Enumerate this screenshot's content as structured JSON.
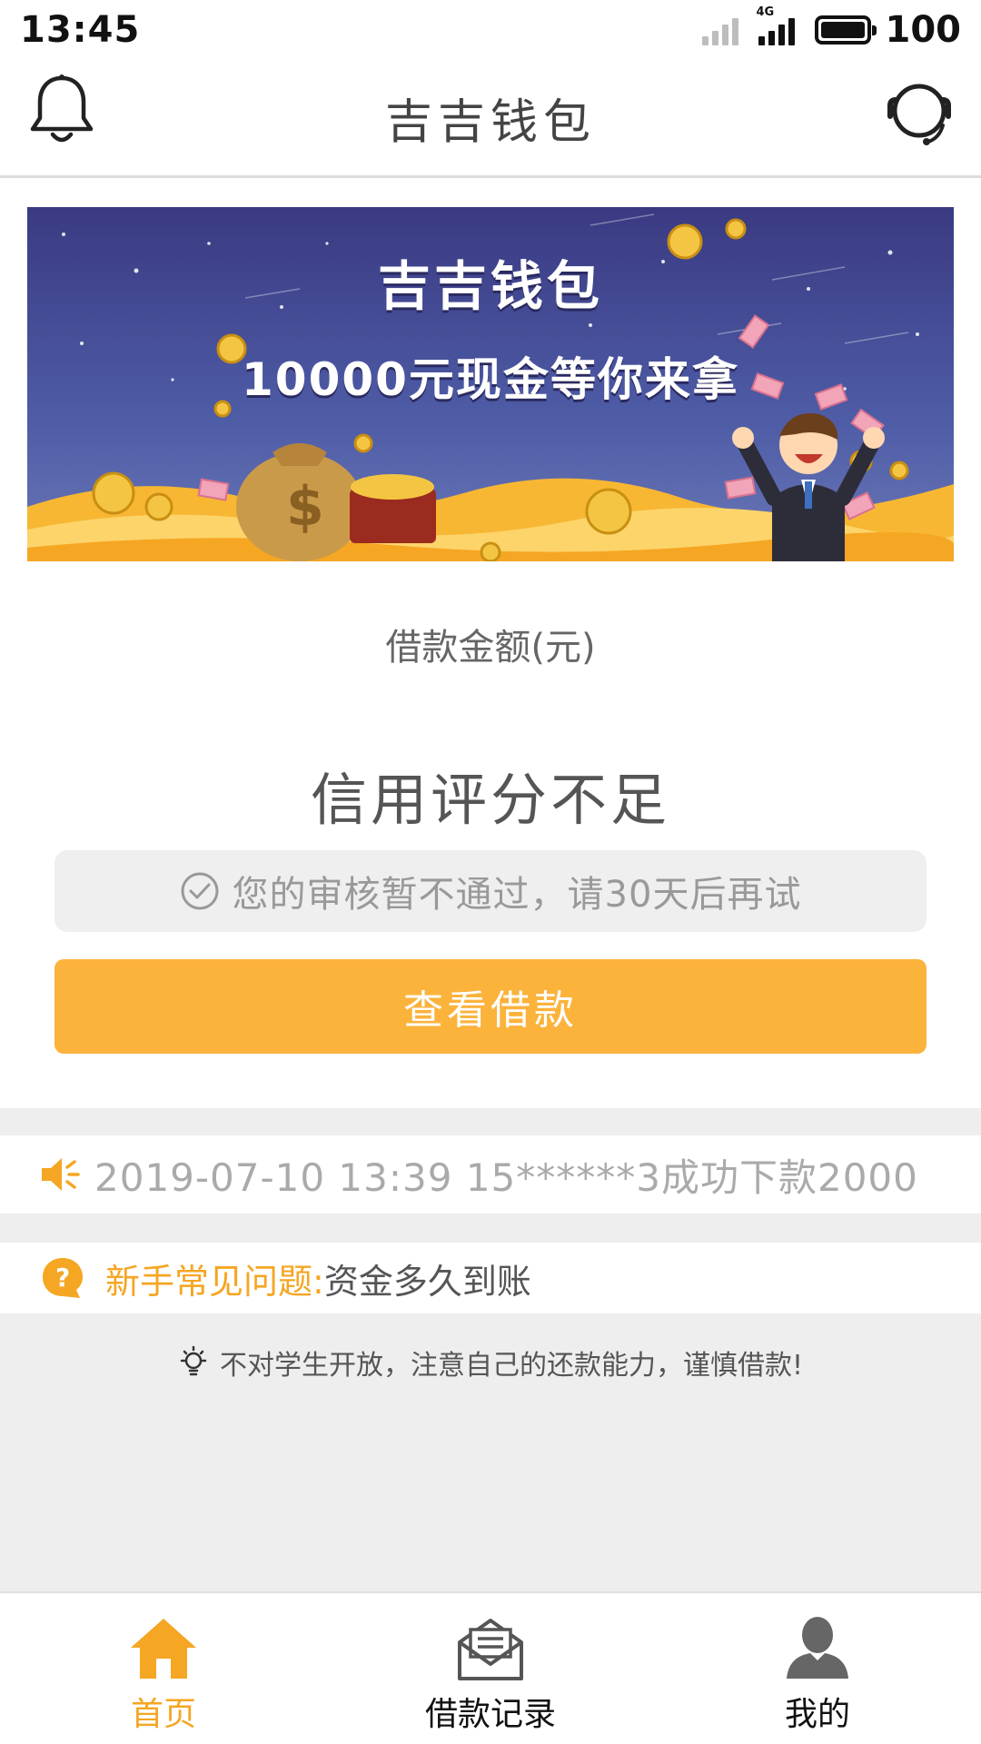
{
  "status_bar": {
    "time": "13:45",
    "network": "4G",
    "battery": "100"
  },
  "header": {
    "title": "吉吉钱包",
    "left_icon": "bell-icon",
    "right_icon": "headset-icon"
  },
  "banner": {
    "title": "吉吉钱包",
    "subtitle": "10000元现金等你来拿"
  },
  "loan": {
    "amount_label": "借款金额(元)",
    "status": "信用评分不足",
    "notice": "您的审核暂不通过，请30天后再试",
    "button_label": "查看借款"
  },
  "marquee": {
    "text": "2019-07-10 13:39 15******3成功下款2000"
  },
  "faq": {
    "label": "新手常见问题:",
    "text": "资金多久到账"
  },
  "tip": {
    "text": "不对学生开放，注意自己的还款能力，谨慎借款!"
  },
  "tabbar": {
    "items": [
      {
        "label": "首页",
        "icon": "home-icon",
        "active": true
      },
      {
        "label": "借款记录",
        "icon": "mail-icon",
        "active": false
      },
      {
        "label": "我的",
        "icon": "user-icon",
        "active": false
      }
    ]
  },
  "colors": {
    "accent": "#fbb33c",
    "accent_text": "#f5a623",
    "muted_text": "#aaaaaa",
    "section_bg": "#eeeeee"
  }
}
